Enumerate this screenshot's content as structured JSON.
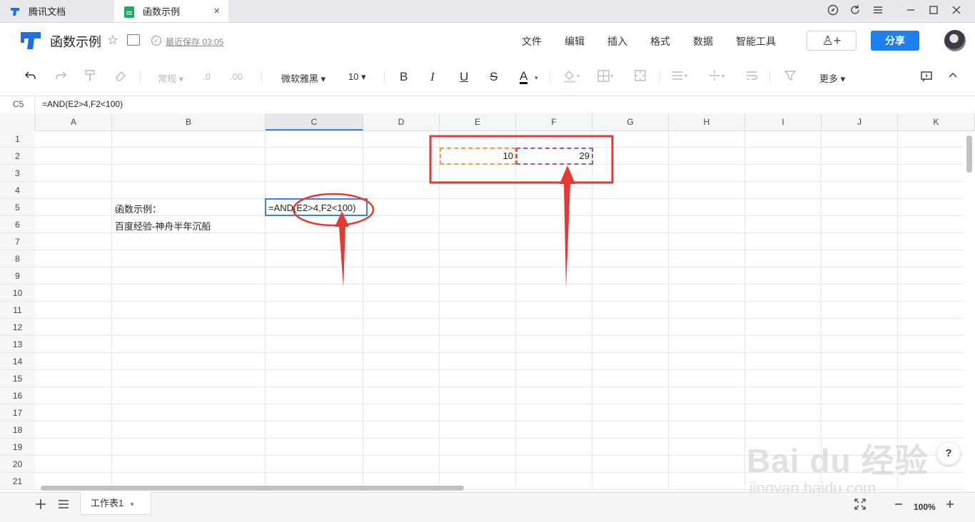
{
  "browser": {
    "tabs": [
      {
        "label": "腾讯文档"
      },
      {
        "label": "函数示例"
      }
    ],
    "tab_close": "×"
  },
  "header": {
    "title": "函数示例",
    "save_status": "最近保存 03:05",
    "menu": [
      "文件",
      "编辑",
      "插入",
      "格式",
      "数据",
      "智能工具"
    ],
    "share_label": "分享",
    "add_user": "♙+"
  },
  "toolbar": {
    "format": "常规",
    "decimal_dec": ".0",
    "decimal_inc": ".00",
    "font": "微软雅黑",
    "font_size": "10",
    "bold": "B",
    "italic": "I",
    "underline": "U",
    "strike": "S",
    "font_color": "A",
    "more": "更多"
  },
  "formula_bar": {
    "cell_ref": "C5",
    "formula": "=AND(E2>4,F2<100)"
  },
  "grid": {
    "columns": [
      "A",
      "B",
      "C",
      "D",
      "E",
      "F",
      "G",
      "H",
      "I",
      "J",
      "K"
    ],
    "rows": [
      "1",
      "2",
      "3",
      "4",
      "5",
      "6",
      "7",
      "8",
      "9",
      "10",
      "11",
      "12",
      "13",
      "14",
      "15",
      "16",
      "17",
      "18",
      "19",
      "20",
      "21"
    ],
    "cells": {
      "B5": "函数示例：",
      "B6": "百度经验-神舟半年沉船",
      "C5": "=AND(E2>4,F2<100)",
      "E2": "10",
      "F2": "29"
    },
    "ref_colors": {
      "E2": "#f0a040",
      "F2": "#9b59b6"
    },
    "annotation_color": "#e53935"
  },
  "sheet": {
    "tab_label": "工作表1",
    "zoom": "100%"
  },
  "help_label": "?",
  "watermark": {
    "line1": "Bai du 经验",
    "line2": "jingyan.baidu.com"
  }
}
